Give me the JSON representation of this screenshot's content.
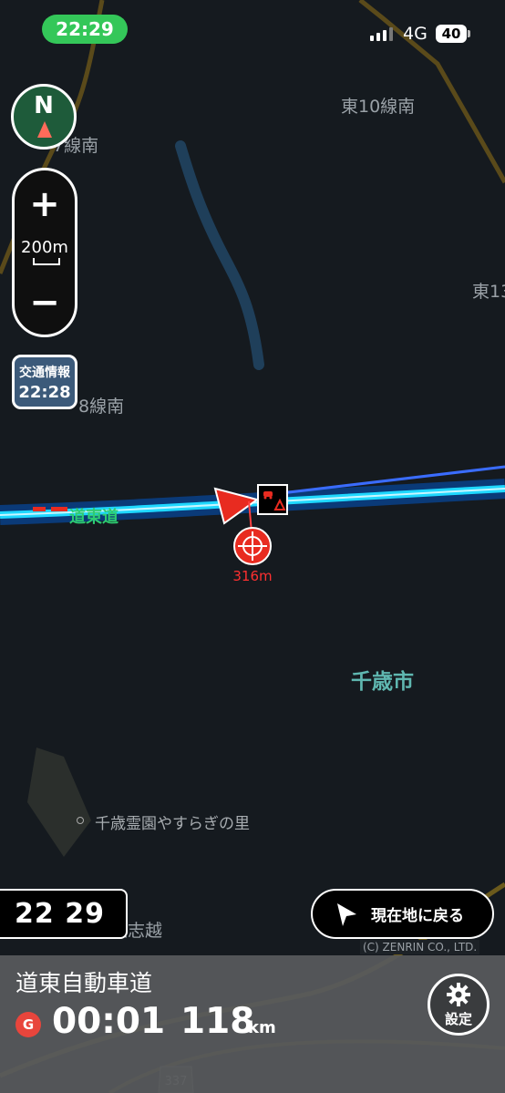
{
  "status_bar": {
    "time": "22:29",
    "network": "4G",
    "battery": "40"
  },
  "map": {
    "labels": {
      "east10": "東10線南",
      "west7": "7線南",
      "east13": "東13",
      "west8": "8線南",
      "highway": "道東道",
      "city": "千歳市",
      "poi": "千歳霊園やすらぎの里",
      "area": "根志越",
      "route_num": "337"
    }
  },
  "compass": {
    "label": "N"
  },
  "zoom": {
    "in": "+",
    "scale": "200m",
    "out": "−"
  },
  "traffic_info": {
    "title": "交通情報",
    "time": "22:28"
  },
  "route": {
    "distance_to_point": "316m"
  },
  "clock": {
    "display": "22 29"
  },
  "return_button": {
    "label": "現在地に戻る"
  },
  "copyright": "(C) ZENRIN CO., LTD.",
  "panel": {
    "road_name": "道東自動車道",
    "goal_badge": "G",
    "eta": "00:01",
    "distance": "118",
    "distance_unit": "km",
    "settings_label": "設定"
  },
  "colors": {
    "route": "#1fd8ff",
    "accent_green": "#34c759",
    "marker_red": "#e82b20",
    "panel": "#58595b"
  }
}
